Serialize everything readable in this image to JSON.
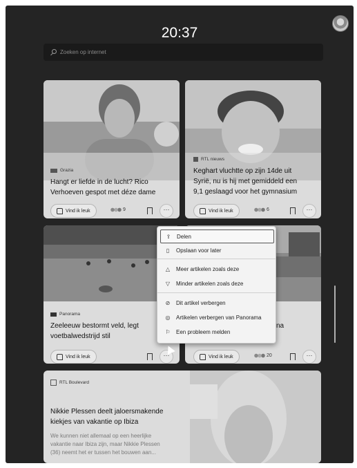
{
  "time": "20:37",
  "search": {
    "placeholder": "Zoeken op internet"
  },
  "cards": [
    {
      "source": "Grazia",
      "title_line1": "Hangt er liefde in de lucht? Rico",
      "title_line2": "Verhoeven gespot met déze dame",
      "like_label": "Vind ik leuk",
      "reactions": "9"
    },
    {
      "source": "RTL nieuws",
      "title_line1": "Keghart vluchtte op zijn 14de uit",
      "title_line2": "Syrië, nu is hij met gemiddeld een",
      "title_line3": "9,1 geslaagd voor het gymnasium",
      "like_label": "Vind ik leuk",
      "reactions": "6"
    },
    {
      "source": "Panorama",
      "title_line1": "Zeeleeuw bestormt veld, legt",
      "title_line2": "voetbalwedstrijd stil",
      "like_label": "Vind ik leuk"
    },
    {
      "title_fragment": "na",
      "like_label": "Vind ik leuk",
      "reactions": "20"
    },
    {
      "source": "RTL Boulevard",
      "title_line1": "Nikkie Plessen deelt jaloersmakende",
      "title_line2": "kiekjes van vakantie op Ibiza",
      "desc_line1": "We kunnen niet allemaal op een heerlijke",
      "desc_line2": "vakantie naar Ibiza zijn, maar Nikkie Plessen",
      "desc_line3": "(36) neemt het er tussen het bouwen aan..."
    }
  ],
  "context_menu": {
    "share": "Delen",
    "save": "Opslaan voor later",
    "more_like": "Meer artikelen zoals deze",
    "less_like": "Minder artikelen zoals deze",
    "hide_article": "Dit artikel verbergen",
    "hide_source": "Artikelen verbergen van Panorama",
    "report": "Een probleem melden"
  }
}
